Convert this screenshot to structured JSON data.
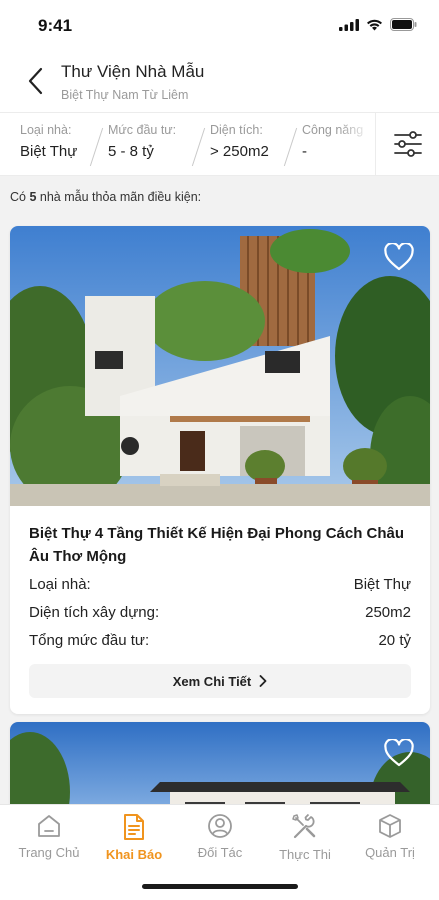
{
  "status_bar": {
    "time": "9:41"
  },
  "header": {
    "title": "Thư Viện Nhà Mẫu",
    "subtitle": "Biệt Thự Nam Từ Liêm",
    "back_icon": "chevron-left-icon"
  },
  "filters": [
    {
      "label": "Loại nhà:",
      "value": "Biệt Thự"
    },
    {
      "label": "Mức đầu tư:",
      "value": "5 - 8 tỷ"
    },
    {
      "label": "Diện tích:",
      "value": "> 250m2"
    },
    {
      "label": "Công năng",
      "value": "-"
    }
  ],
  "filter_settings_icon": "sliders-icon",
  "result": {
    "prefix": "Có",
    "count": "5",
    "suffix": "nhà mẫu thỏa mãn điều kiện:"
  },
  "cards": [
    {
      "title": "Biệt Thự 4 Tầng Thiết Kế Hiện Đại Phong Cách Châu Âu Thơ Mộng",
      "rows": [
        {
          "label": "Loại nhà:",
          "value": "Biệt Thự"
        },
        {
          "label": "Diện tích xây dựng:",
          "value": "250m2"
        },
        {
          "label": "Tổng mức đầu tư:",
          "value": "20 tỷ"
        }
      ],
      "detail_label": "Xem Chi Tiết",
      "favorite_icon": "heart-outline-icon"
    },
    {
      "favorite_icon": "heart-outline-icon"
    }
  ],
  "bottom_nav": [
    {
      "label": "Trang Chủ",
      "icon": "home-icon",
      "active": false
    },
    {
      "label": "Khai Báo",
      "icon": "document-icon",
      "active": true
    },
    {
      "label": "Đối Tác",
      "icon": "user-circle-icon",
      "active": false
    },
    {
      "label": "Thực Thi",
      "icon": "tools-icon",
      "active": false
    },
    {
      "label": "Quản Trị",
      "icon": "cube-icon",
      "active": false
    }
  ],
  "colors": {
    "accent": "#f0941e",
    "inactive": "#9a9a9a",
    "background": "#f2f2f2"
  }
}
